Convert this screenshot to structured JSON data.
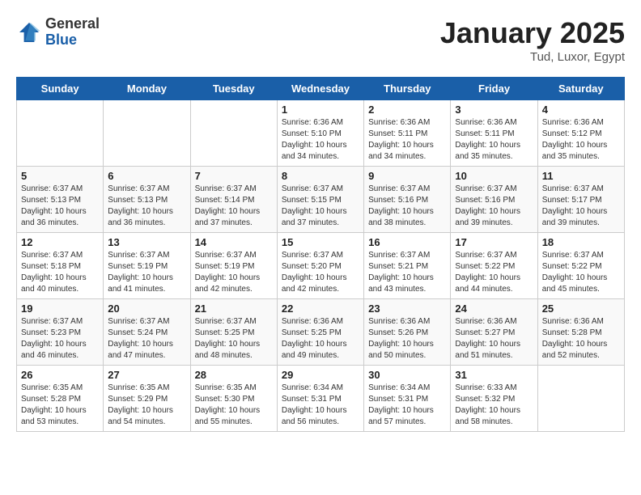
{
  "header": {
    "logo_general": "General",
    "logo_blue": "Blue",
    "title": "January 2025",
    "subtitle": "Tud, Luxor, Egypt"
  },
  "days_of_week": [
    "Sunday",
    "Monday",
    "Tuesday",
    "Wednesday",
    "Thursday",
    "Friday",
    "Saturday"
  ],
  "weeks": [
    [
      {
        "day": "",
        "info": ""
      },
      {
        "day": "",
        "info": ""
      },
      {
        "day": "",
        "info": ""
      },
      {
        "day": "1",
        "info": "Sunrise: 6:36 AM\nSunset: 5:10 PM\nDaylight: 10 hours\nand 34 minutes."
      },
      {
        "day": "2",
        "info": "Sunrise: 6:36 AM\nSunset: 5:11 PM\nDaylight: 10 hours\nand 34 minutes."
      },
      {
        "day": "3",
        "info": "Sunrise: 6:36 AM\nSunset: 5:11 PM\nDaylight: 10 hours\nand 35 minutes."
      },
      {
        "day": "4",
        "info": "Sunrise: 6:36 AM\nSunset: 5:12 PM\nDaylight: 10 hours\nand 35 minutes."
      }
    ],
    [
      {
        "day": "5",
        "info": "Sunrise: 6:37 AM\nSunset: 5:13 PM\nDaylight: 10 hours\nand 36 minutes."
      },
      {
        "day": "6",
        "info": "Sunrise: 6:37 AM\nSunset: 5:13 PM\nDaylight: 10 hours\nand 36 minutes."
      },
      {
        "day": "7",
        "info": "Sunrise: 6:37 AM\nSunset: 5:14 PM\nDaylight: 10 hours\nand 37 minutes."
      },
      {
        "day": "8",
        "info": "Sunrise: 6:37 AM\nSunset: 5:15 PM\nDaylight: 10 hours\nand 37 minutes."
      },
      {
        "day": "9",
        "info": "Sunrise: 6:37 AM\nSunset: 5:16 PM\nDaylight: 10 hours\nand 38 minutes."
      },
      {
        "day": "10",
        "info": "Sunrise: 6:37 AM\nSunset: 5:16 PM\nDaylight: 10 hours\nand 39 minutes."
      },
      {
        "day": "11",
        "info": "Sunrise: 6:37 AM\nSunset: 5:17 PM\nDaylight: 10 hours\nand 39 minutes."
      }
    ],
    [
      {
        "day": "12",
        "info": "Sunrise: 6:37 AM\nSunset: 5:18 PM\nDaylight: 10 hours\nand 40 minutes."
      },
      {
        "day": "13",
        "info": "Sunrise: 6:37 AM\nSunset: 5:19 PM\nDaylight: 10 hours\nand 41 minutes."
      },
      {
        "day": "14",
        "info": "Sunrise: 6:37 AM\nSunset: 5:19 PM\nDaylight: 10 hours\nand 42 minutes."
      },
      {
        "day": "15",
        "info": "Sunrise: 6:37 AM\nSunset: 5:20 PM\nDaylight: 10 hours\nand 42 minutes."
      },
      {
        "day": "16",
        "info": "Sunrise: 6:37 AM\nSunset: 5:21 PM\nDaylight: 10 hours\nand 43 minutes."
      },
      {
        "day": "17",
        "info": "Sunrise: 6:37 AM\nSunset: 5:22 PM\nDaylight: 10 hours\nand 44 minutes."
      },
      {
        "day": "18",
        "info": "Sunrise: 6:37 AM\nSunset: 5:22 PM\nDaylight: 10 hours\nand 45 minutes."
      }
    ],
    [
      {
        "day": "19",
        "info": "Sunrise: 6:37 AM\nSunset: 5:23 PM\nDaylight: 10 hours\nand 46 minutes."
      },
      {
        "day": "20",
        "info": "Sunrise: 6:37 AM\nSunset: 5:24 PM\nDaylight: 10 hours\nand 47 minutes."
      },
      {
        "day": "21",
        "info": "Sunrise: 6:37 AM\nSunset: 5:25 PM\nDaylight: 10 hours\nand 48 minutes."
      },
      {
        "day": "22",
        "info": "Sunrise: 6:36 AM\nSunset: 5:25 PM\nDaylight: 10 hours\nand 49 minutes."
      },
      {
        "day": "23",
        "info": "Sunrise: 6:36 AM\nSunset: 5:26 PM\nDaylight: 10 hours\nand 50 minutes."
      },
      {
        "day": "24",
        "info": "Sunrise: 6:36 AM\nSunset: 5:27 PM\nDaylight: 10 hours\nand 51 minutes."
      },
      {
        "day": "25",
        "info": "Sunrise: 6:36 AM\nSunset: 5:28 PM\nDaylight: 10 hours\nand 52 minutes."
      }
    ],
    [
      {
        "day": "26",
        "info": "Sunrise: 6:35 AM\nSunset: 5:28 PM\nDaylight: 10 hours\nand 53 minutes."
      },
      {
        "day": "27",
        "info": "Sunrise: 6:35 AM\nSunset: 5:29 PM\nDaylight: 10 hours\nand 54 minutes."
      },
      {
        "day": "28",
        "info": "Sunrise: 6:35 AM\nSunset: 5:30 PM\nDaylight: 10 hours\nand 55 minutes."
      },
      {
        "day": "29",
        "info": "Sunrise: 6:34 AM\nSunset: 5:31 PM\nDaylight: 10 hours\nand 56 minutes."
      },
      {
        "day": "30",
        "info": "Sunrise: 6:34 AM\nSunset: 5:31 PM\nDaylight: 10 hours\nand 57 minutes."
      },
      {
        "day": "31",
        "info": "Sunrise: 6:33 AM\nSunset: 5:32 PM\nDaylight: 10 hours\nand 58 minutes."
      },
      {
        "day": "",
        "info": ""
      }
    ]
  ]
}
